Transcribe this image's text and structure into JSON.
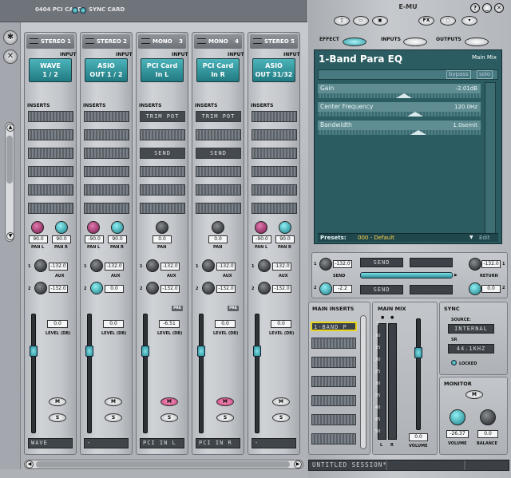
{
  "top": {
    "card_label": "0404 PCI CARD",
    "sync_label": "SYNC CARD"
  },
  "strips": [
    {
      "type": "STEREO",
      "num": "1",
      "input": [
        "WAVE",
        "1 / 2"
      ],
      "inserts": [
        "",
        "",
        "",
        "",
        "",
        ""
      ],
      "pan_left": "90.0",
      "pan_right": "90.0",
      "pan_labels": [
        "PAN L",
        "PAN R"
      ],
      "aux1": "-132.0",
      "aux2": "-132.0",
      "level": "0.0",
      "pre": false,
      "name": "WAVE",
      "knob": "magenta"
    },
    {
      "type": "STEREO",
      "num": "2",
      "input": [
        "ASIO",
        "OUT 1 / 2"
      ],
      "inserts": [
        "",
        "",
        "",
        "",
        "",
        ""
      ],
      "pan_left": "-90.0",
      "pan_right": "90.0",
      "pan_labels": [
        "PAN L",
        "PAN R"
      ],
      "aux1": "-132.0",
      "aux2": "0.0",
      "level": "0.0",
      "pre": false,
      "name": "-",
      "knob": "magenta"
    },
    {
      "type": "MONO",
      "num": "3",
      "input": [
        "PCI Card",
        "In L"
      ],
      "inserts": [
        "TRIM POT",
        "",
        "SEND",
        "",
        "",
        ""
      ],
      "pan": "0.0",
      "pan_label": "PAN",
      "aux1": "-132.0",
      "aux2": "-132.0",
      "level": "-6.51",
      "pre": true,
      "name": "PCI IN L"
    },
    {
      "type": "MONO",
      "num": "4",
      "input": [
        "PCI Card",
        "In R"
      ],
      "inserts": [
        "TRIM POT",
        "",
        "SEND",
        "",
        "",
        ""
      ],
      "pan": "0.0",
      "pan_label": "PAN",
      "aux1": "-132.0",
      "aux2": "-132.0",
      "level": "0.0",
      "pre": true,
      "name": "PCI IN R"
    },
    {
      "type": "STEREO",
      "num": "5",
      "input": [
        "ASIO",
        "OUT 31/32"
      ],
      "inserts": [
        "",
        "",
        "",
        "",
        "",
        ""
      ],
      "pan_left": "-90.0",
      "pan_right": "90.0",
      "pan_labels": [
        "PAN L",
        "PAN R"
      ],
      "aux1": "-132.0",
      "aux2": "-132.0",
      "level": "0.0",
      "pre": false,
      "name": "-",
      "knob": "magenta"
    }
  ],
  "labels": {
    "input": "INPUT",
    "inserts": "INSERTS",
    "aux": "AUX",
    "level": "LEVEL (DB)",
    "pre": "PRE",
    "mute": "M",
    "solo": "S"
  },
  "right": {
    "logo": "E-MU",
    "tabs": {
      "effect": "EFFECT",
      "inputs": "INPUTS",
      "outputs": "OUTPUTS"
    },
    "eq": {
      "title": "1-Band Para EQ",
      "mix_label": "Main Mix",
      "bypass": "bypass",
      "solo": "solo",
      "params": [
        {
          "label": "Gain",
          "value": "-2.01dB",
          "pos": 0.53
        },
        {
          "label": "Center Frequency",
          "value": "120.0Hz",
          "pos": 0.6
        },
        {
          "label": "Bandwidth",
          "value": "1.0semit",
          "pos": 0.62
        }
      ],
      "presets_label": "Presets:",
      "preset_value": "000 - Default",
      "edit_label": "Edit"
    },
    "send": {
      "aux1": "-132.0",
      "aux2": "-2.2",
      "send_label": "SEND",
      "return_label": "RETURN",
      "return1": "-132.0",
      "return2": "0.0",
      "slot1": "SEND",
      "slot2": "SEND"
    },
    "main_inserts": {
      "title": "MAIN INSERTS",
      "first": "1-BAND P"
    },
    "main_mix": {
      "title": "MAIN MIX",
      "scale": [
        "5",
        "10",
        "15",
        "20",
        "25",
        "30",
        "35",
        "40",
        "45",
        "50"
      ],
      "l": "L",
      "r": "R",
      "volume": "0.0",
      "volume_label": "VOLUME"
    },
    "sync": {
      "title": "SYNC",
      "source_label": "SOURCE:",
      "source": "INTERNAL",
      "sr_label": "SR",
      "sr": "44.1KHZ",
      "locked": "LOCKED"
    },
    "monitor": {
      "title": "MONITOR",
      "mute": "M",
      "volume": "-26.37",
      "balance": "0.0",
      "volume_label": "VOLUME",
      "balance_label": "BALANCE"
    },
    "session": "UNTITLED SESSION*"
  }
}
